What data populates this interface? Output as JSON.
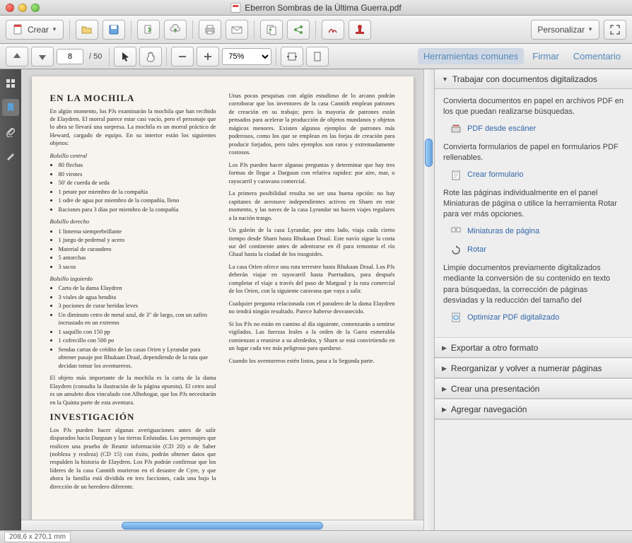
{
  "window": {
    "title": "Eberron Sombras de la Última Guerra.pdf"
  },
  "toolbar": {
    "create_label": "Crear",
    "personalize_label": "Personalizar"
  },
  "nav": {
    "current_page": "8",
    "total_pages": "50",
    "zoom": "75%"
  },
  "toolbar_links": {
    "common_tools": "Herramientas comunes",
    "sign": "Firmar",
    "comment": "Comentario"
  },
  "sidepanel": {
    "s1": {
      "title": "Trabajar con documentos digitalizados",
      "p1": "Convierta documentos en papel en archivos PDF en los que puedan realizarse búsquedas.",
      "link1": "PDF desde escáner",
      "p2": "Convierta formularios de papel en formularios PDF rellenables.",
      "link2": "Crear formulario",
      "p3": "Rote las páginas individualmente en el panel Miniaturas de página o utilice la herramienta Rotar para ver más opciones.",
      "link3": "Miniaturas de página",
      "link4": "Rotar",
      "p4": "Limpie documentos previamente digitalizados mediante la conversión de su contenido en texto para búsquedas, la corrección de páginas desviadas y la reducción del tamaño del",
      "link5": "Optimizar PDF digitalizado"
    },
    "s2": {
      "title": "Exportar a otro formato"
    },
    "s3": {
      "title": "Reorganizar y volver a numerar páginas"
    },
    "s4": {
      "title": "Crear una presentación"
    },
    "s5": {
      "title": "Agregar navegación"
    }
  },
  "doc": {
    "h1": "EN LA MOCHILA",
    "intro": "En algún momento, los PJs examinarán la mochila que han recibido de Elaydren. El morral parece estar casi vacío, pero el personaje que lo abra se llevará una sorpresa. La mochila es un morral práctico de Heward, cargado de equipo. En su interior están los siguientes objetos:",
    "sec1_label": "Bolsillo central",
    "sec1_items": [
      "80 flechas",
      "80 virotes",
      "50' de cuerda de seda",
      "1 petate por miembro de la compañía",
      "1 odre de agua por miembro de la compañía, lleno",
      "Raciones para 3 días por miembro de la compañía"
    ],
    "sec2_label": "Bolsillo derecho",
    "sec2_items": [
      "1 linterna siemprebrillante",
      "1 juego de pedernal y acero",
      "Material de curandero",
      "5 antorchas",
      "3 sacos"
    ],
    "sec3_label": "Bolsillo izquierdo",
    "sec3_items": [
      "Carta de la dama Elaydren",
      "3 viales de agua bendita",
      "3 pociones de curar heridas leves",
      "Un diminuto cetro de metal azul, de 3\" de largo, con un zafiro incrustado en un extremo",
      "1 saquillo con 150 pp",
      "1 cofrecillo con 500 po",
      "Sendas cartas de crédito de las casas Orien y Lyrandar para obtener pasaje por Rhukaan Draal, dependiendo de la ruta que decidan tomar los aventureros."
    ],
    "para2": "El objeto más importante de la mochila es la carta de la dama Elaydren (consulta la ilustración de la página opuesta). El cetro azul es un amuleto dios vinculado con Alhohogar, que los PJs necesitarán en la Quinta parte de esta aventura.",
    "h2": "INVESTIGACIÓN",
    "para3": "Los PJs pueden hacer algunas averiguaciones antes de salir disparados hacia Darguun y las tierras Enlutadas. Los personajes que realicen una prueba de Reunir información (CD 20) o de Saber (nobleza y realeza) (CD 15) con éxito, podrán obtener datos que respalden la historia de Elaydren. Los PJs podrán confirmar que los líderes de la casa Cannith murieron en el desastre de Cyre, y que ahora la familia está dividida en tres facciones, cada una bajo la dirección de un heredero diferente.",
    "col2_p1": "Unas pocas pesquisas con algún estudioso de lo arcano podrán corroborar que los inventores de la casa Cannith emplean patrones de creación en su trabajo; pero la mayoría de patrones están pensados para acelerar la producción de objetos mundanos y objetos mágicos menores. Existen algunos ejemplos de patrones más poderosos, como los que se emplean en las forjas de creación para producir forjados, pero tales ejemplos son raros y extremadamente costosos.",
    "col2_p2": "Los PJs pueden hacer algunas preguntas y determinar que hay tres formas de llegar a Darguun con relativa rapidez: por aire, mar, o rayocarril y caravana comercial.",
    "col2_p3": "La primera posibilidad resulta no ser una buena opción: no hay capitanes de aeronave independientes activos en Sharn en este momento, y las naves de la casa Lyrandar no hacen viajes regulares a la nación trasgo.",
    "col2_p4": "Un galeón de la casa Lyrandar, por otro lado, viaja cada cierto tiempo desde Sharn hasta Rhukaan Draal. Este navío sigue la costa sur del continente antes de adentrarse en él para remontar el río Ghaal hasta la ciudad de los trasgoides.",
    "col2_p5": "La casa Orien ofrece una ruta terrestre hasta Rhukaan Draal. Los PJs deberán viajar en rayocarril hasta Puertadura, para después completar el viaje a través del paso de Marguul y la ruta comercial de los Orien, con la siguiente caravana que vaya a salir.",
    "col2_p6": "Cualquier pregunta relacionada con el paradero de la dama Elaydren no tendrá ningún resultado. Parece haberse desvanecido.",
    "col2_p7": "Si los PJs no están en camino al día siguiente, comenzarán a sentirse vigilados. Las fuerzas leales a la orden de la Garra esmeralda comienzan a reunirse a su alrededor, y Sharn se está convirtiendo en un lugar cada vez más peligroso para quedarse.",
    "col2_p8": "Cuando los aventureros estén listos, pasa a la Segunda parte."
  },
  "status": {
    "dims": "208,6 x 270,1 mm"
  }
}
